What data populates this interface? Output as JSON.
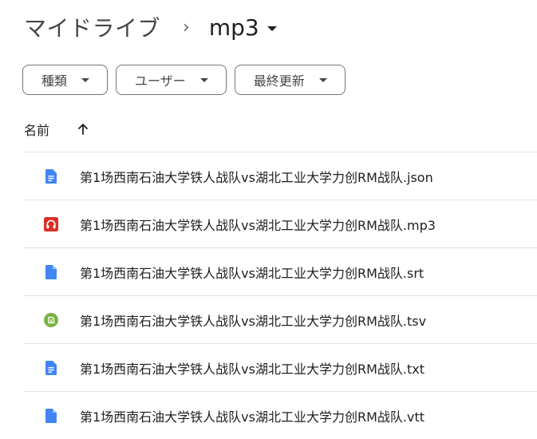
{
  "breadcrumb": {
    "root": "マイドライブ",
    "separator": "›",
    "current": "mp3"
  },
  "filters": [
    {
      "label": "種類"
    },
    {
      "label": "ユーザー"
    },
    {
      "label": "最終更新"
    }
  ],
  "sort": {
    "column_label": "名前",
    "direction_icon": "arrow-up-icon"
  },
  "colors": {
    "doc_blue": "#4285f4",
    "audio_red": "#d93025",
    "sheet_green": "#7cb342",
    "divider": "#e1e3e1"
  },
  "files": [
    {
      "name": "第1场西南石油大学铁人战队vs湖北工业大学力创RM战队.json",
      "icon": "google-docs-icon"
    },
    {
      "name": "第1场西南石油大学铁人战队vs湖北工业大学力创RM战队.mp3",
      "icon": "audio-file-icon"
    },
    {
      "name": "第1场西南石油大学铁人战队vs湖北工业大学力创RM战队.srt",
      "icon": "file-icon"
    },
    {
      "name": "第1场西南石油大学铁人战队vs湖北工业大学力创RM战队.tsv",
      "icon": "green-file-icon"
    },
    {
      "name": "第1场西南石油大学铁人战队vs湖北工业大学力创RM战队.txt",
      "icon": "google-docs-icon"
    },
    {
      "name": "第1场西南石油大学铁人战队vs湖北工业大学力创RM战队.vtt",
      "icon": "file-icon"
    }
  ]
}
